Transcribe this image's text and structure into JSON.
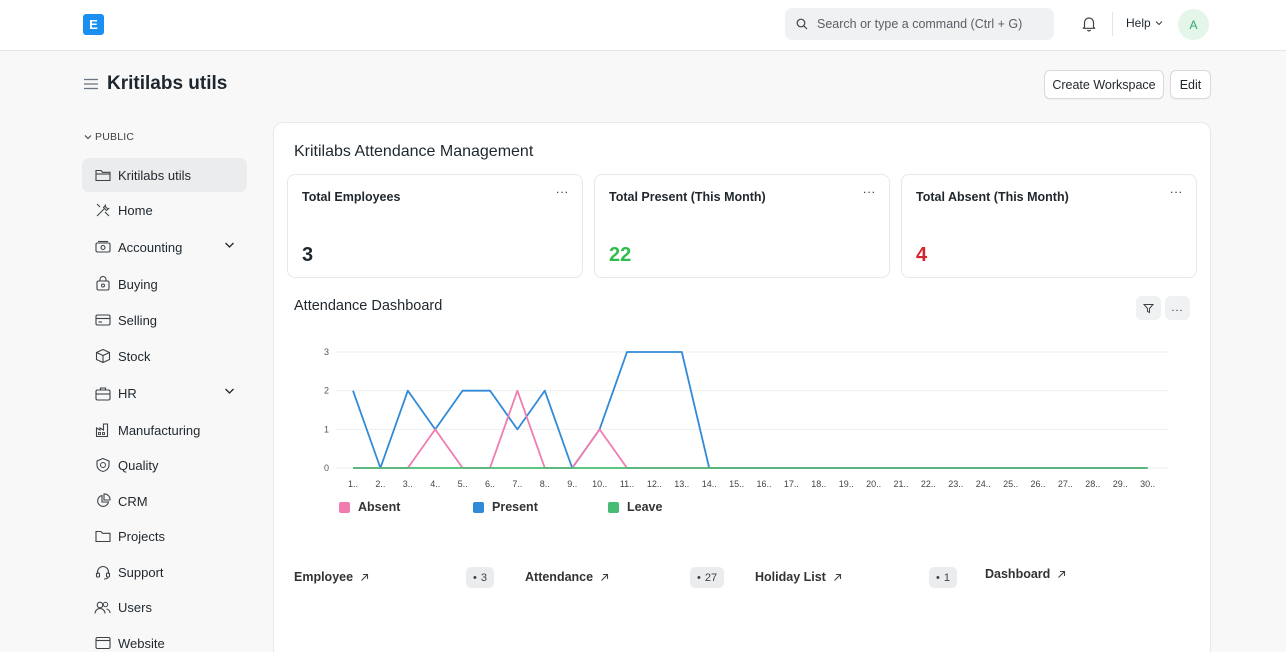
{
  "navbar": {
    "logo_letter": "E",
    "search_placeholder": "Search or type a command (Ctrl + G)",
    "help_label": "Help",
    "avatar_letter": "A"
  },
  "page": {
    "title": "Kritilabs utils",
    "create_workspace_label": "Create Workspace",
    "edit_label": "Edit"
  },
  "sidebar": {
    "section_label": "PUBLIC",
    "items": [
      {
        "label": "Kritilabs utils",
        "icon": "folder-icon",
        "active": true
      },
      {
        "label": "Home",
        "icon": "tools-icon"
      },
      {
        "label": "Accounting",
        "icon": "accounting-icon",
        "expandable": true
      },
      {
        "label": "Buying",
        "icon": "buying-icon"
      },
      {
        "label": "Selling",
        "icon": "selling-icon"
      },
      {
        "label": "Stock",
        "icon": "box-icon"
      },
      {
        "label": "HR",
        "icon": "hr-icon",
        "expandable": true
      },
      {
        "label": "Manufacturing",
        "icon": "factory-icon"
      },
      {
        "label": "Quality",
        "icon": "quality-icon"
      },
      {
        "label": "CRM",
        "icon": "crm-icon"
      },
      {
        "label": "Projects",
        "icon": "projects-icon"
      },
      {
        "label": "Support",
        "icon": "headset-icon"
      },
      {
        "label": "Users",
        "icon": "users-icon"
      },
      {
        "label": "Website",
        "icon": "website-icon"
      }
    ]
  },
  "main": {
    "section_title": "Kritilabs Attendance Management",
    "stats": [
      {
        "label": "Total Employees",
        "value": "3",
        "color": "#1f272e"
      },
      {
        "label": "Total Present (This Month)",
        "value": "22",
        "color": "#2ebd4e"
      },
      {
        "label": "Total Absent (This Month)",
        "value": "4",
        "color": "#d0282e"
      }
    ],
    "more_label": "...",
    "chart_title": "Attendance Dashboard",
    "shortcuts": [
      {
        "label": "Employee",
        "count": "3"
      },
      {
        "label": "Attendance",
        "count": "27"
      },
      {
        "label": "Holiday List",
        "count": "1"
      },
      {
        "label": "Dashboard",
        "count": null
      }
    ]
  },
  "chart_data": {
    "type": "line",
    "title": "Attendance Dashboard",
    "x": [
      "1..",
      "2..",
      "3..",
      "4..",
      "5..",
      "6..",
      "7..",
      "8..",
      "9..",
      "10..",
      "11..",
      "12..",
      "13..",
      "14..",
      "15..",
      "16..",
      "17..",
      "18..",
      "19..",
      "20..",
      "21..",
      "22..",
      "23..",
      "24..",
      "25..",
      "26..",
      "27..",
      "28..",
      "29..",
      "30.."
    ],
    "ylim": [
      0,
      3
    ],
    "yticks": [
      0,
      1,
      2,
      3
    ],
    "grid": true,
    "legend_position": "bottom-left",
    "series": [
      {
        "name": "Absent",
        "color": "#f17cb0",
        "values": [
          0,
          0,
          0,
          1,
          0,
          0,
          2,
          0,
          0,
          1,
          0,
          0,
          0,
          0,
          0,
          0,
          0,
          0,
          0,
          0,
          0,
          0,
          0,
          0,
          0,
          0,
          0,
          0,
          0,
          0
        ]
      },
      {
        "name": "Present",
        "color": "#318ad8",
        "values": [
          2,
          0,
          2,
          1,
          2,
          2,
          1,
          2,
          0,
          1,
          3,
          3,
          3,
          0,
          0,
          0,
          0,
          0,
          0,
          0,
          0,
          0,
          0,
          0,
          0,
          0,
          0,
          0,
          0,
          0
        ]
      },
      {
        "name": "Leave",
        "color": "#48bb74",
        "values": [
          0,
          0,
          0,
          0,
          0,
          0,
          0,
          0,
          0,
          0,
          0,
          0,
          0,
          0,
          0,
          0,
          0,
          0,
          0,
          0,
          0,
          0,
          0,
          0,
          0,
          0,
          0,
          0,
          0,
          0
        ]
      }
    ]
  }
}
